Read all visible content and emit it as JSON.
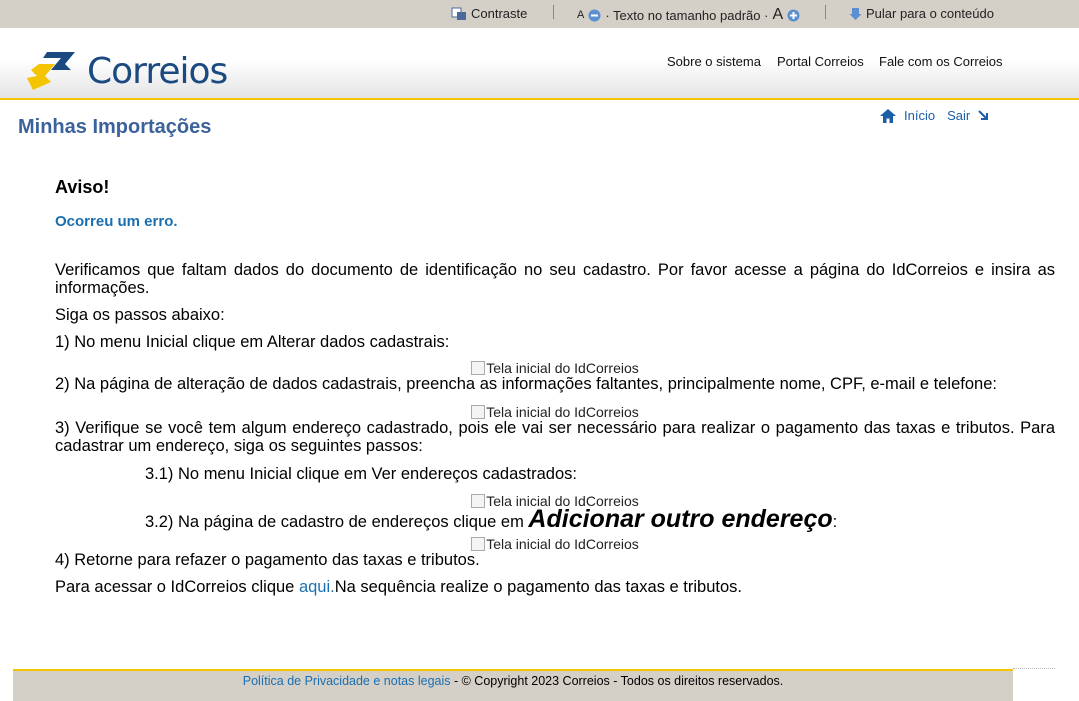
{
  "topbar": {
    "contraste": "Contraste",
    "font_small": "A",
    "font_text": "· Texto no tamanho padrão ·",
    "font_large": "A",
    "skip": "Pular para o conteúdo"
  },
  "header": {
    "logo_text": "Correios",
    "nav": [
      "Sobre o sistema",
      "Portal Correios",
      "Fale com os Correios"
    ]
  },
  "page": {
    "title": "Minhas Importações",
    "inicio": "Início",
    "sair": "Sair"
  },
  "content": {
    "aviso": "Aviso!",
    "erro": "Ocorreu um erro.",
    "intro": "Verificamos que faltam dados do documento de identificação no seu cadastro. Por favor acesse a página do IdCorreios e insira as informações.",
    "siga": "Siga os passos abaixo:",
    "step1": "1) No menu Inicial clique em Alterar dados cadastrais:",
    "img_alt": "Tela inicial do IdCorreios",
    "step2": "2) Na página de alteração de dados cadastrais, preencha as informações faltantes, principalmente nome, CPF, e-mail e telefone:",
    "step3": "3) Verifique se você tem algum endereço cadastrado, pois ele vai ser necessário para realizar o pagamento das taxas e tributos. Para cadastrar um endereço, siga os seguintes passos:",
    "step31": "3.1) No menu Inicial clique em Ver endereços cadastrados:",
    "step32_pre": "3.2) Na página de cadastro de endereços clique em ",
    "step32_big": "Adicionar outro endereço",
    "step32_post": ":",
    "step4": "4) Retorne para refazer o pagamento das taxas e tributos.",
    "final_pre": "Para acessar o IdCorreios clique ",
    "final_link": "aqui.",
    "final_post": "Na sequência realize o pagamento das taxas e tributos."
  },
  "footer": {
    "privacy": "Política de Privacidade e notas legais",
    "copyright": " - © Copyright  2023  Correios - Todos os direitos reservados."
  },
  "colors": {
    "brand_blue": "#1a4a80",
    "brand_yellow": "#f5c400",
    "link_blue": "#1a6fb0",
    "topbar_bg": "#d4d0c8"
  }
}
